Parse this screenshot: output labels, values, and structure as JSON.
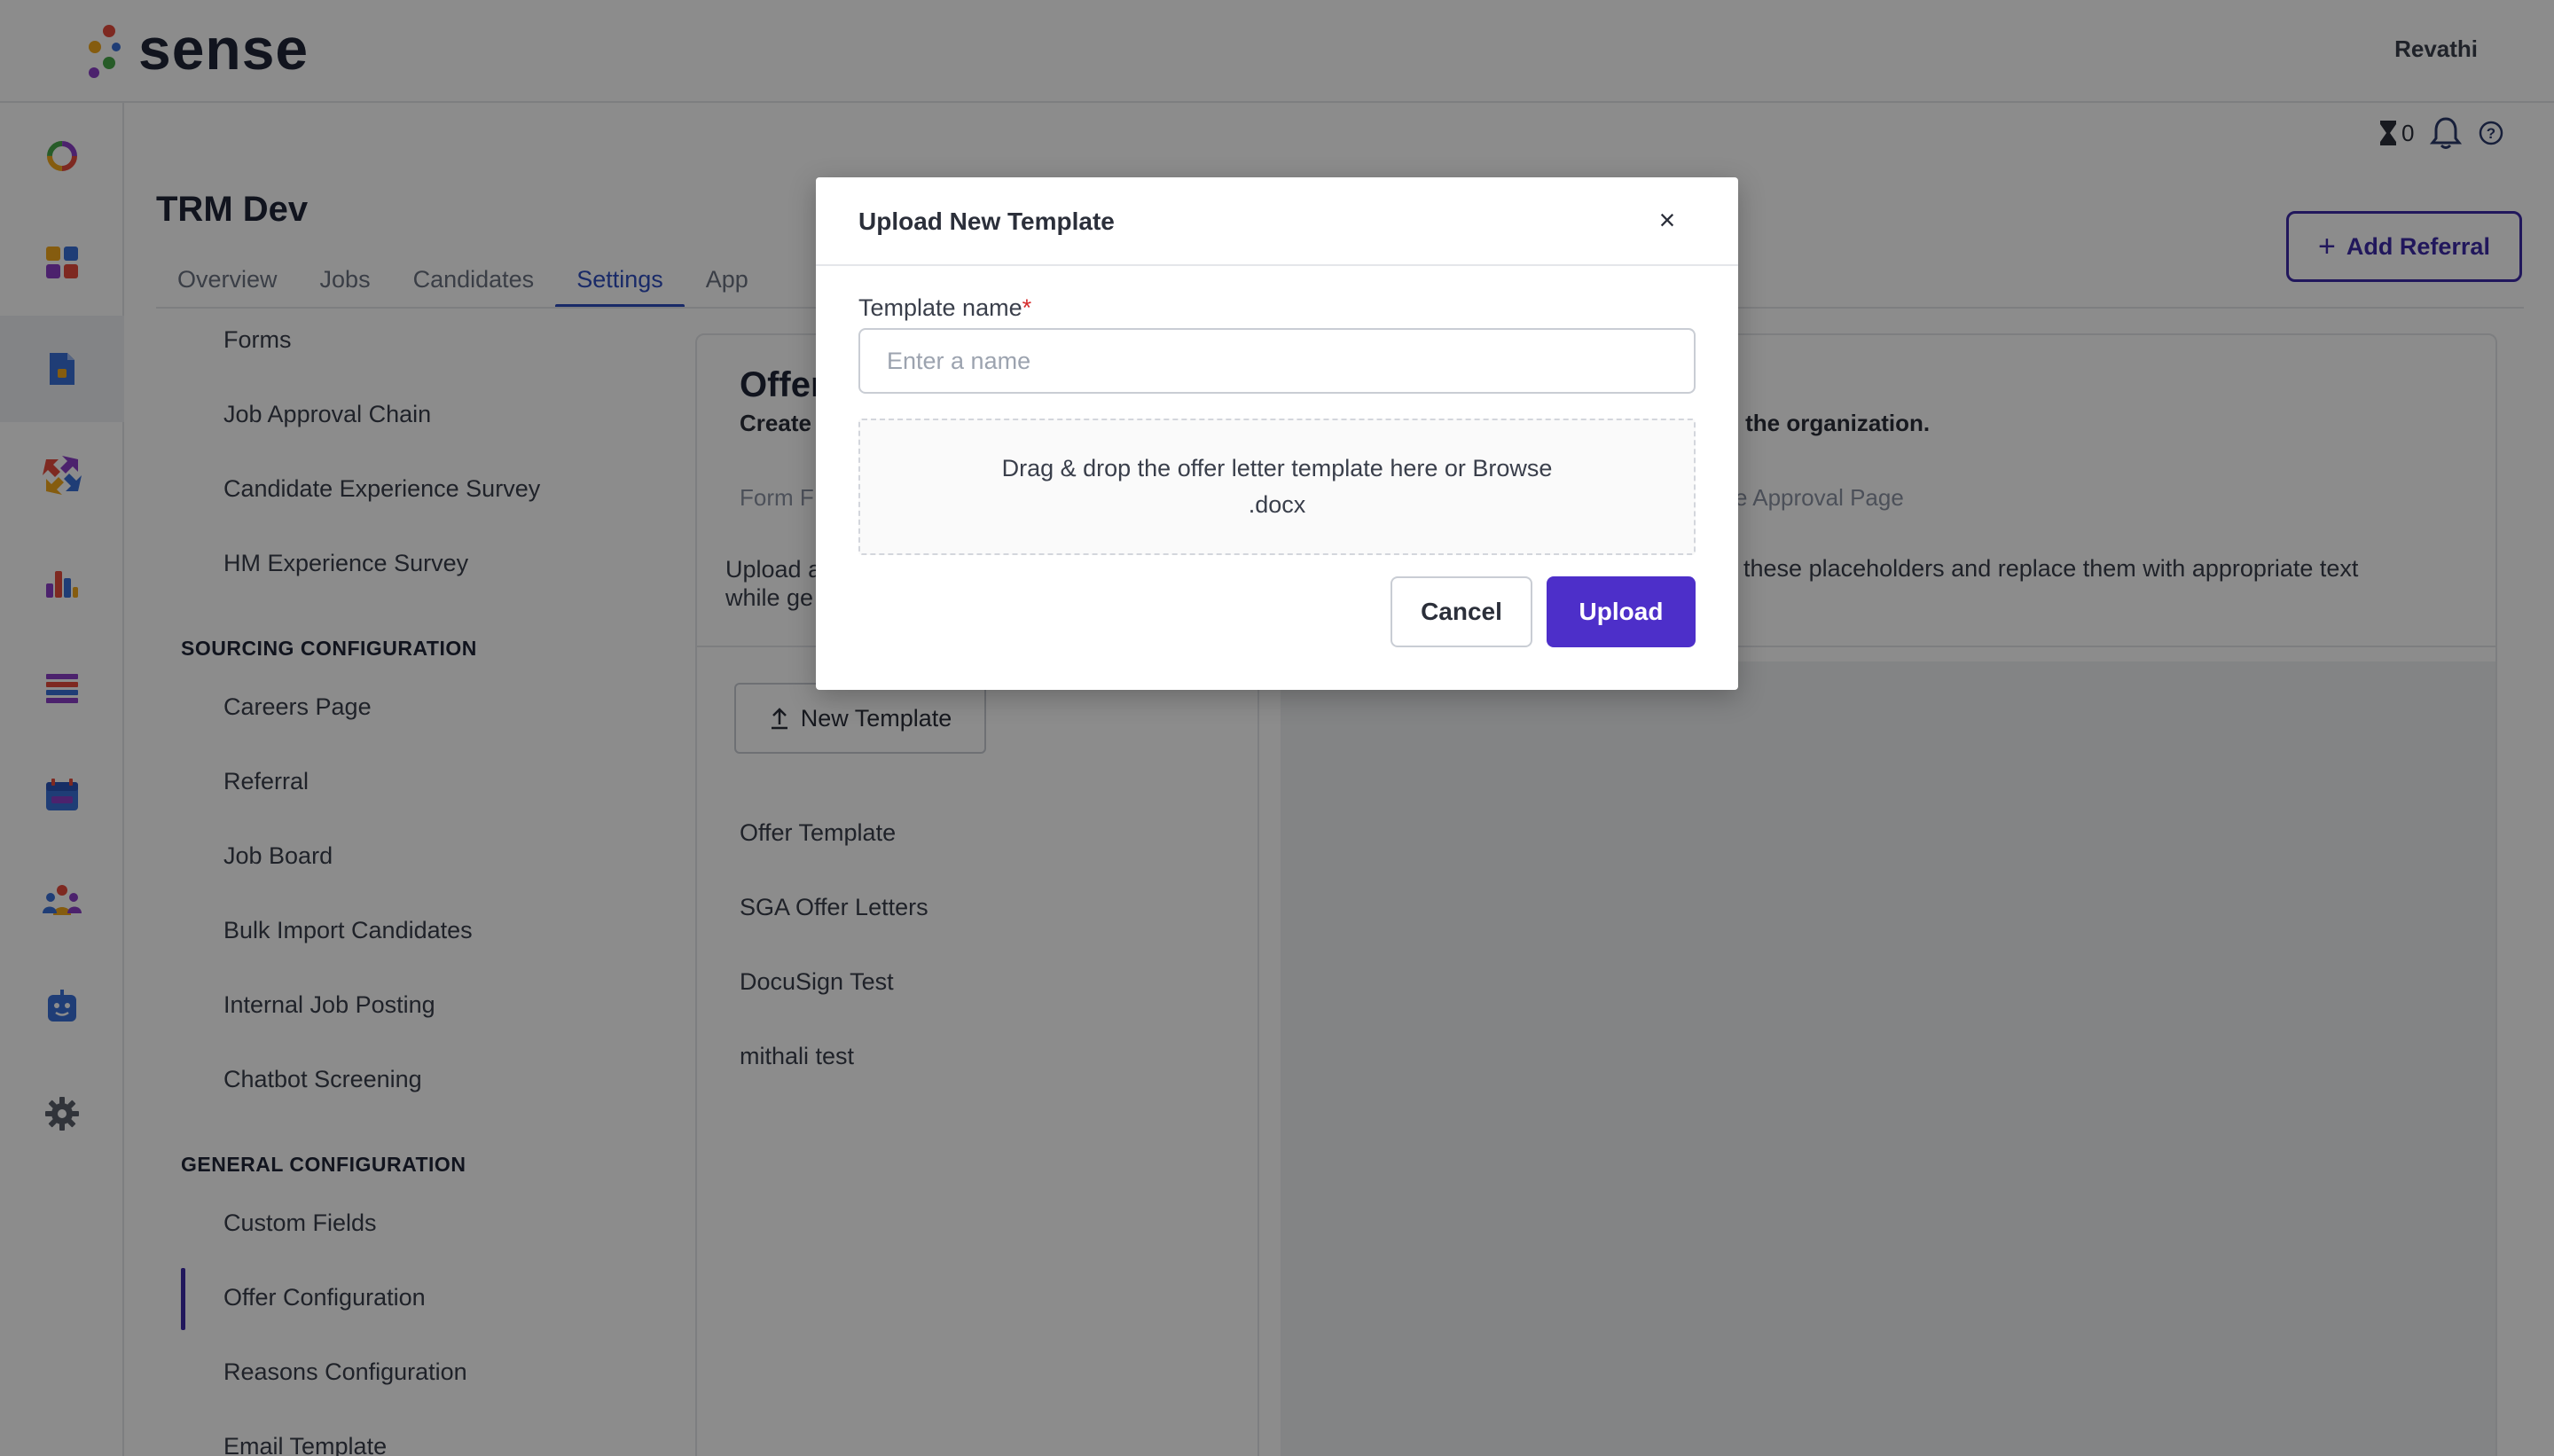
{
  "app": {
    "brand": "sense",
    "user_name": "Revathi"
  },
  "utilities": {
    "timer_count": "0"
  },
  "page": {
    "title": "TRM Dev",
    "add_referral_label": "Add Referral"
  },
  "tabs": [
    {
      "label": "Overview"
    },
    {
      "label": "Jobs"
    },
    {
      "label": "Candidates"
    },
    {
      "label": "Settings"
    },
    {
      "label": "App"
    }
  ],
  "settings_nav": {
    "items_top": [
      "Forms",
      "Job Approval Chain",
      "Candidate Experience Survey",
      "HM Experience Survey"
    ],
    "sourcing_title": "SOURCING CONFIGURATION",
    "sourcing_items": [
      "Careers Page",
      "Referral",
      "Job Board",
      "Bulk Import Candidates",
      "Internal Job Posting",
      "Chatbot Screening"
    ],
    "general_title": "GENERAL CONFIGURATION",
    "general_items": [
      "Custom Fields",
      "Offer Configuration",
      "Reasons Configuration",
      "Email Template"
    ]
  },
  "content": {
    "title": "Offer",
    "subtitle_start": "Create",
    "subtitle_end": "ss the organization.",
    "link_form": "Form F",
    "link_approval": "e Approval Page",
    "desc_start": "Upload a",
    "desc_line2": "while ge",
    "desc_end": "ize these placeholders and replace them with appropriate text",
    "new_template_label": "New Template",
    "templates": [
      "Offer Template",
      "SGA Offer Letters",
      "DocuSign Test",
      "mithali test"
    ]
  },
  "modal": {
    "title": "Upload New Template",
    "close_symbol": "×",
    "field_label": "Template name",
    "required_mark": "*",
    "field_placeholder": "Enter a name",
    "field_value": "",
    "dropzone_text": "Drag & drop the offer letter template here or Browse",
    "dropzone_ext": ".docx",
    "cancel_label": "Cancel",
    "upload_label": "Upload"
  },
  "colors": {
    "accent": "#4d2fc9",
    "tab_active": "#2f4dbd",
    "overlay": "rgba(0,0,0,0.45)",
    "logo_dots": [
      "#e64b3c",
      "#f2a81d",
      "#47a84a",
      "#3a6fd8",
      "#8a3fc6"
    ]
  },
  "icons": {
    "rail": [
      "dashboard-ring-icon",
      "grid-icon",
      "document-icon",
      "sourcing-icon",
      "bar-chart-icon",
      "list-icon",
      "calendar-icon",
      "people-icon",
      "bot-icon",
      "gear-icon"
    ],
    "utility": [
      "hourglass-icon",
      "bell-icon",
      "help-icon"
    ]
  }
}
